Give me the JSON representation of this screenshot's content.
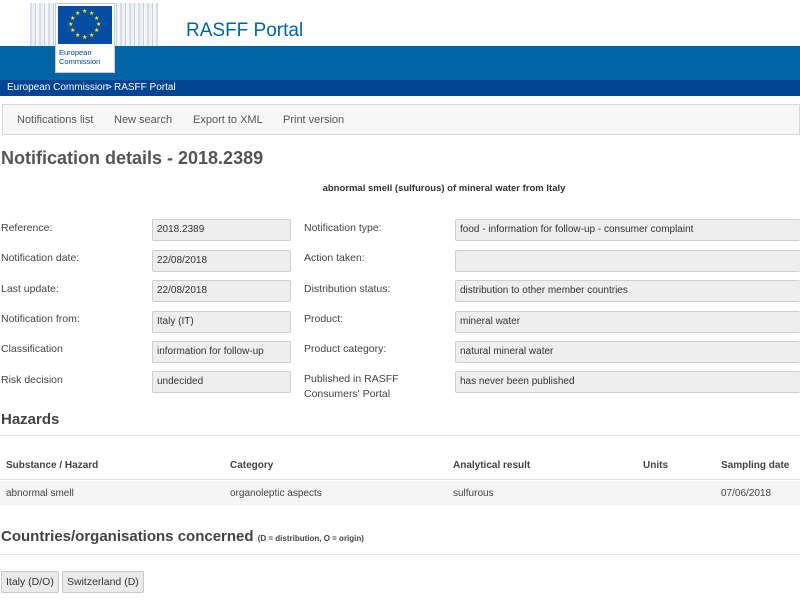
{
  "header": {
    "logo_line1": "European",
    "logo_line2": "Commission",
    "portal_title": "RASFF Portal"
  },
  "breadcrumb": {
    "item1": "European Commission",
    "separator": ">",
    "item2": "RASFF Portal"
  },
  "toolbar": {
    "notifications_list": "Notifications list",
    "new_search": "New search",
    "export_xml": "Export to XML",
    "print_version": "Print version"
  },
  "page": {
    "title": "Notification details - 2018.2389",
    "subject": "abnormal smell (sulfurous) of mineral water from Italy"
  },
  "details": {
    "reference_label": "Reference:",
    "reference_value": "2018.2389",
    "notification_date_label": "Notification date:",
    "notification_date_value": "22/08/2018",
    "last_update_label": "Last update:",
    "last_update_value": "22/08/2018",
    "notification_from_label": "Notification from:",
    "notification_from_value": "Italy (IT)",
    "classification_label": "Classification",
    "classification_value": "information for follow-up",
    "risk_decision_label": "Risk decision",
    "risk_decision_value": "undecided",
    "notification_type_label": "Notification type:",
    "notification_type_value": "food - information for follow-up - consumer complaint",
    "action_taken_label": "Action taken:",
    "action_taken_value": "",
    "distribution_status_label": "Distribution status:",
    "distribution_status_value": "distribution to other member countries",
    "product_label": "Product:",
    "product_value": "mineral water",
    "product_category_label": "Product category:",
    "product_category_value": "natural mineral water",
    "published_label_line1": "Published in RASFF",
    "published_label_line2": "Consumers' Portal",
    "published_value": "has never been published"
  },
  "hazards": {
    "heading": "Hazards",
    "columns": [
      "Substance / Hazard",
      "Category",
      "Analytical result",
      "Units",
      "Sampling date"
    ],
    "rows": [
      [
        "abnormal smell",
        "organoleptic aspects",
        "sulfurous",
        "",
        "07/06/2018"
      ]
    ]
  },
  "countries": {
    "heading": "Countries/organisations concerned",
    "note": "(D = distribution, O = origin)",
    "items": [
      "Italy (D/O)",
      "Switzerland (D)"
    ]
  },
  "colors": {
    "brand_blue": "#0065a2",
    "dark_blue": "#004494",
    "eu_flag_blue": "#034ea2",
    "eu_star_yellow": "#ffed00"
  }
}
